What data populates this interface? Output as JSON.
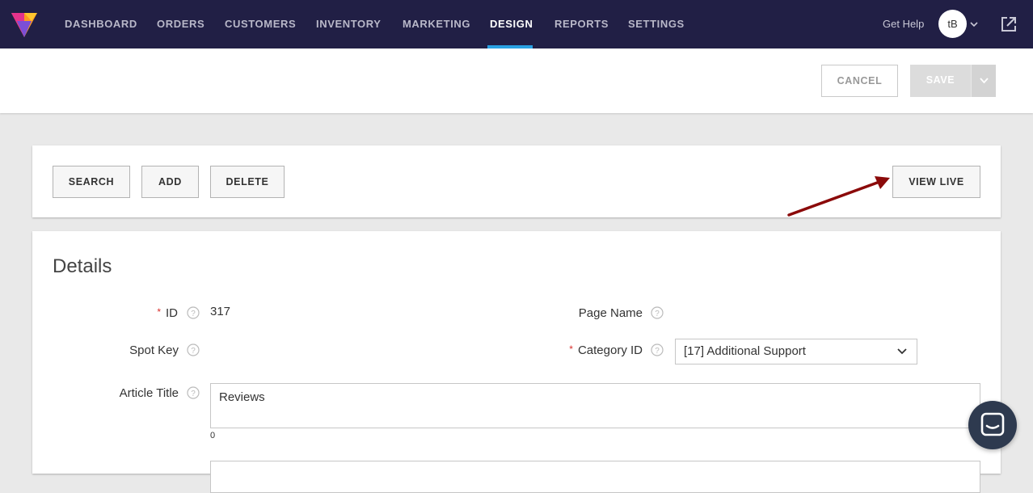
{
  "nav": {
    "items": [
      {
        "label": "DASHBOARD",
        "active": false
      },
      {
        "label": "ORDERS",
        "active": false
      },
      {
        "label": "CUSTOMERS",
        "active": false
      },
      {
        "label": "INVENTORY",
        "active": false
      },
      {
        "label": "MARKETING",
        "active": false
      },
      {
        "label": "DESIGN",
        "active": true
      },
      {
        "label": "REPORTS",
        "active": false
      },
      {
        "label": "SETTINGS",
        "active": false
      }
    ],
    "get_help": "Get Help",
    "avatar_initials": "tB",
    "accent_color": "#2aa1e3",
    "bar_color": "#211f45"
  },
  "actionbar": {
    "cancel_label": "CANCEL",
    "save_label": "SAVE"
  },
  "toolbar": {
    "search_label": "SEARCH",
    "add_label": "ADD",
    "delete_label": "DELETE",
    "view_live_label": "VIEW LIVE"
  },
  "details": {
    "title": "Details",
    "id_label": "ID",
    "id_value": "317",
    "page_name_label": "Page Name",
    "spot_key_label": "Spot Key",
    "category_label": "Category ID",
    "category_value": "[17] Additional Support",
    "article_title_label": "Article Title",
    "article_title_value": "Reviews",
    "article_title_count": "0"
  },
  "annotation_color": "#8b0a0a"
}
